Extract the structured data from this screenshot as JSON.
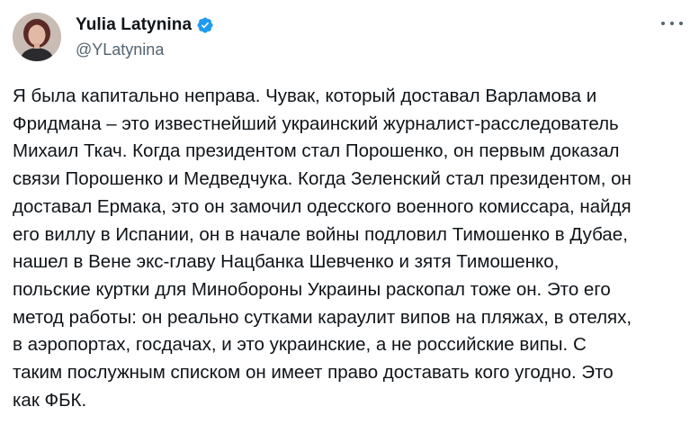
{
  "author": {
    "name": "Yulia Latynina",
    "handle": "@YLatynina",
    "avatar_icon": "user-portrait",
    "verified_icon": "verified-badge-icon"
  },
  "colors": {
    "text": "#0f1419",
    "secondary_text": "#536471",
    "verified": "#1d9bf0",
    "background": "#ffffff"
  },
  "more_icon": "more-horizontal-icon",
  "post": {
    "lines": [
      "Я была капитально неправа. Чувак, который доставал Варламова и",
      "Фридмана – это известнейший украинский журналист-расследователь",
      "Михаил Ткач. Когда президентом стал Порошенко, он первым доказал",
      "связи Порошенко и Медведчука. Когда Зеленский стал президентом, он",
      "доставал Ермака, это он замочил одесского военного комиссара, найдя",
      "его виллу в Испании, он в начале войны подловил Тимошенко в Дубае,",
      "нашел в Вене экс-главу Нацбанка Шевченко и зятя Тимошенко,",
      "польские куртки для Минобороны Украины раскопал тоже он. Это его",
      "метод работы: он реально сутками караулит випов на пляжах, в отелях,",
      "в аэропортах, госдачах, и это украинские, а не российские випы. С",
      "таким послужным списком он имеет право доставать кого угодно. Это",
      "как ФБК."
    ]
  }
}
